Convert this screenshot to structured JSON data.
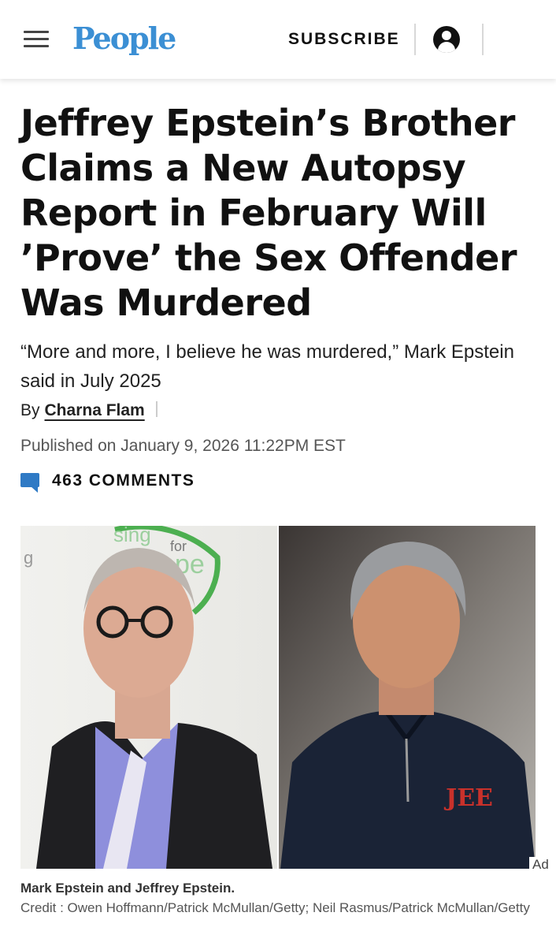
{
  "header": {
    "logo_text": "People",
    "subscribe_label": "SUBSCRIBE",
    "menu_icon": "hamburger-menu-icon",
    "account_icon": "user-account-icon",
    "brand_color": "#3b8fd4"
  },
  "article": {
    "headline": "Jeffrey Epstein’s Brother Claims a New Autopsy Report in February Will ’Prove’ the Sex Offender Was Murdered",
    "dek": "“More and more, I believe he was murdered,” Mark Epstein said in July 2025",
    "byline_prefix": "By",
    "author": "Charna Flam",
    "published": "Published on January 9, 2026 11:22PM EST",
    "comments_label": "463 COMMENTS",
    "comment_icon": "comment-bubble-icon",
    "accent_color": "#2f7ac5"
  },
  "photo": {
    "left_sign_text_1": "sing",
    "left_sign_text_2": "for",
    "left_sign_text_3": "pe",
    "left_sign_text_4": "g",
    "sweater_monogram": "JEE",
    "ad_label": "Ad"
  },
  "caption": {
    "title": "Mark Epstein and Jeffrey Epstein.",
    "credit": "Credit : Owen Hoffmann/Patrick McMullan/Getty; Neil Rasmus/Patrick McMullan/Getty"
  }
}
